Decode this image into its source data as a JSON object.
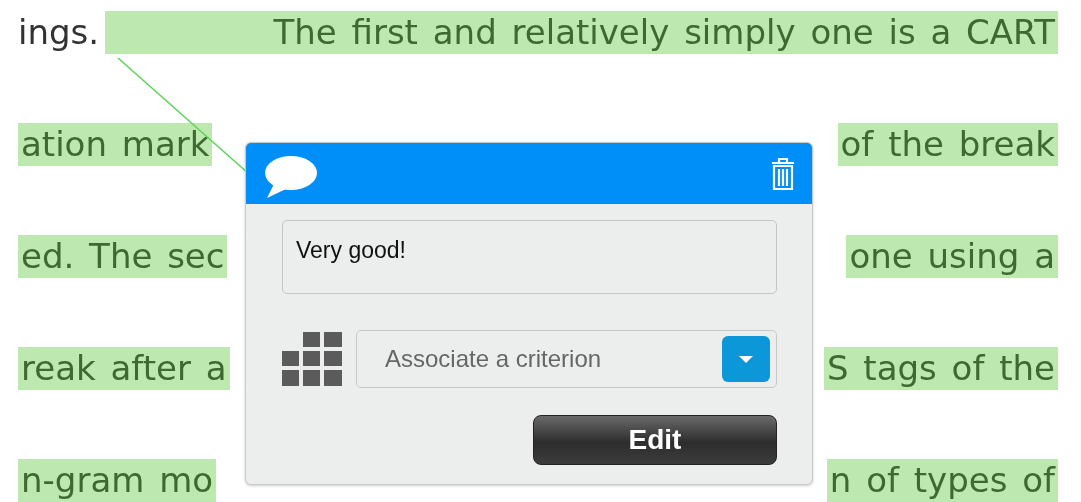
{
  "text_lines": [
    {
      "segments": [
        {
          "text": "ings.",
          "highlighted": false
        },
        {
          "text": "The first and relatively simply one is a CART",
          "highlighted": true
        }
      ]
    },
    {
      "segments": [
        {
          "text": "ation mark",
          "highlighted": true
        },
        {
          "text": "of the break",
          "highlighted": true
        }
      ]
    },
    {
      "segments": [
        {
          "text": "ed. The sec",
          "highlighted": true
        },
        {
          "text": "one using a",
          "highlighted": true
        }
      ]
    },
    {
      "segments": [
        {
          "text": "reak after a",
          "highlighted": true
        },
        {
          "text": "S tags of the",
          "highlighted": true
        }
      ]
    },
    {
      "segments": [
        {
          "text": "n-gram mo",
          "highlighted": true
        },
        {
          "text": "n of types of",
          "highlighted": true
        }
      ]
    }
  ],
  "comment": {
    "text": "Very good!",
    "criterion": {
      "placeholder": "Associate a criterion"
    },
    "edit_button": "Edit"
  }
}
